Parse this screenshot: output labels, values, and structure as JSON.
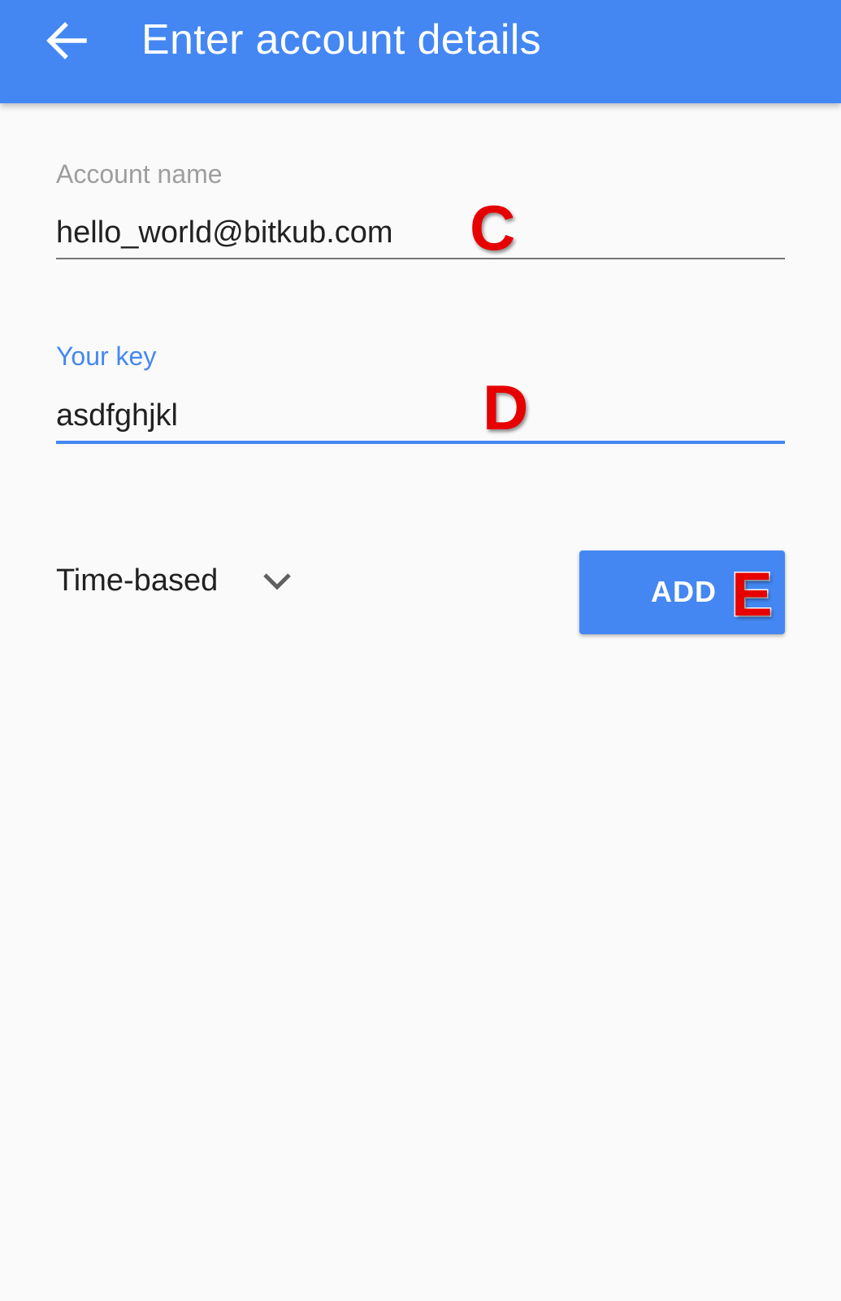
{
  "app_bar": {
    "title": "Enter account details",
    "back_icon": "arrow-back-icon",
    "color": "#4487f3"
  },
  "form": {
    "account_name": {
      "label": "Account name",
      "value": "hello_world@bitkub.com"
    },
    "key": {
      "label": "Your key",
      "value": "asdfghjkl"
    },
    "type_select": {
      "selected": "Time-based",
      "icon": "chevron-down-icon"
    },
    "add_button": {
      "label": "ADD"
    }
  },
  "annotations": {
    "marker_c": "C",
    "marker_d": "D",
    "marker_e": "E",
    "color": "#e60000"
  }
}
